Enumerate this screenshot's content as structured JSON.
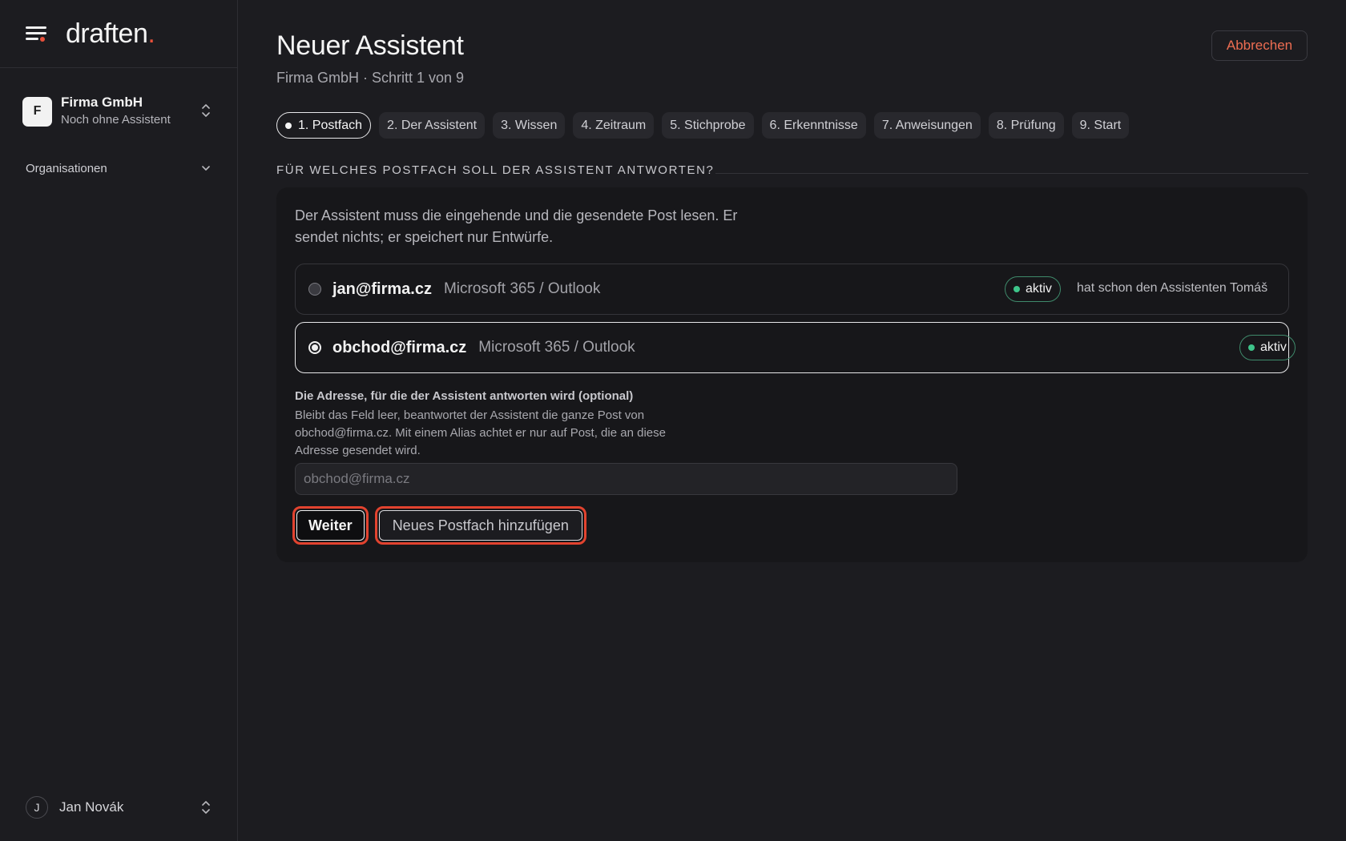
{
  "brand": {
    "logo_text": "draften",
    "logo_dot": ".",
    "accent": "#e8503a"
  },
  "sidebar": {
    "org": {
      "avatar_letter": "F",
      "name": "Firma GmbH",
      "subtitle": "Noch ohne Assistent"
    },
    "organizations_label": "Organisationen",
    "user": {
      "avatar_letter": "J",
      "name": "Jan Novák"
    }
  },
  "header": {
    "title": "Neuer Assistent",
    "subtitle": "Firma GmbH · Schritt 1 von 9",
    "cancel_label": "Abbrechen"
  },
  "steps": [
    {
      "label": "1. Postfach",
      "active": true
    },
    {
      "label": "2. Der Assistent"
    },
    {
      "label": "3. Wissen"
    },
    {
      "label": "4. Zeitraum"
    },
    {
      "label": "5. Stichprobe"
    },
    {
      "label": "6. Erkenntnisse"
    },
    {
      "label": "7. Anweisungen"
    },
    {
      "label": "8. Prüfung"
    },
    {
      "label": "9. Start"
    }
  ],
  "section": {
    "heading": "FÜR WELCHES POSTFACH SOLL DER ASSISTENT ANTWORTEN?",
    "intro": "Der Assistent muss die eingehende und die gesendete Post lesen. Er sendet nichts; er speichert nur Entwürfe.",
    "mailboxes": [
      {
        "email": "jan@firma.cz",
        "provider": "Microsoft 365 / Outlook",
        "status": "aktiv",
        "note": "hat schon den Assistenten Tomáš",
        "selected": false
      },
      {
        "email": "obchod@firma.cz",
        "provider": "Microsoft 365 / Outlook",
        "status": "aktiv",
        "note": "",
        "selected": true
      }
    ],
    "alias_field": {
      "label": "Die Adresse, für die der Assistent antworten wird (optional)",
      "help": "Bleibt das Feld leer, beantwortet der Assistent die ganze Post von obchod@firma.cz. Mit einem Alias achtet er nur auf Post, die an diese Adresse gesendet wird.",
      "placeholder": "obchod@firma.cz",
      "value": ""
    },
    "next_label": "Weiter",
    "add_mailbox_label": "Neues Postfach hinzufügen"
  },
  "colors": {
    "status_green": "#3ec48a",
    "cancel_text": "#ee6d52",
    "highlight_ring": "#e2432f"
  }
}
